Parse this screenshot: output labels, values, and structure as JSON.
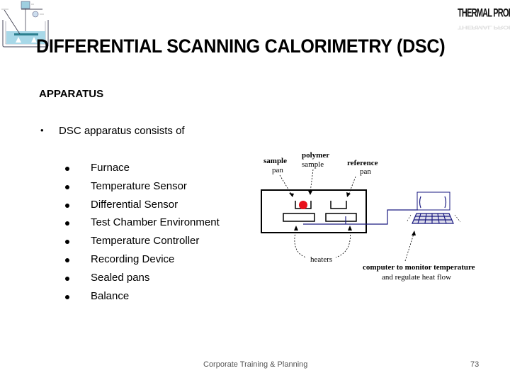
{
  "slide": {
    "title": "DIFFERENTIAL SCANNING CALORIMETRY (DSC)",
    "section_heading": "APPARATUS",
    "intro_bullet": "•",
    "intro_text": "DSC apparatus consists of",
    "items": [
      {
        "label": "Furnace"
      },
      {
        "label": "Temperature Sensor"
      },
      {
        "label": "Differential Sensor"
      },
      {
        "label": "Test Chamber Environment"
      },
      {
        "label": "Temperature Controller"
      },
      {
        "label": "Recording Device"
      },
      {
        "label": "Sealed pans"
      },
      {
        "label": "Balance"
      }
    ]
  },
  "logo": {
    "text": "THERMAL PROPERTIES"
  },
  "diagram": {
    "labels": {
      "sample_pan_line1": "sample",
      "sample_pan_line2": "pan",
      "polymer_line1": "polymer",
      "polymer_line2": "sample",
      "reference_line1": "reference",
      "reference_line2": "pan",
      "heaters": "heaters",
      "computer_line1": "computer to monitor temperature",
      "computer_line2": "and regulate heat flow"
    },
    "colors": {
      "sample": "#e8101a",
      "wire": "#1a1a80",
      "outline": "#000000"
    }
  },
  "footer": {
    "text": "Corporate Training & Planning",
    "page_number": "73"
  }
}
